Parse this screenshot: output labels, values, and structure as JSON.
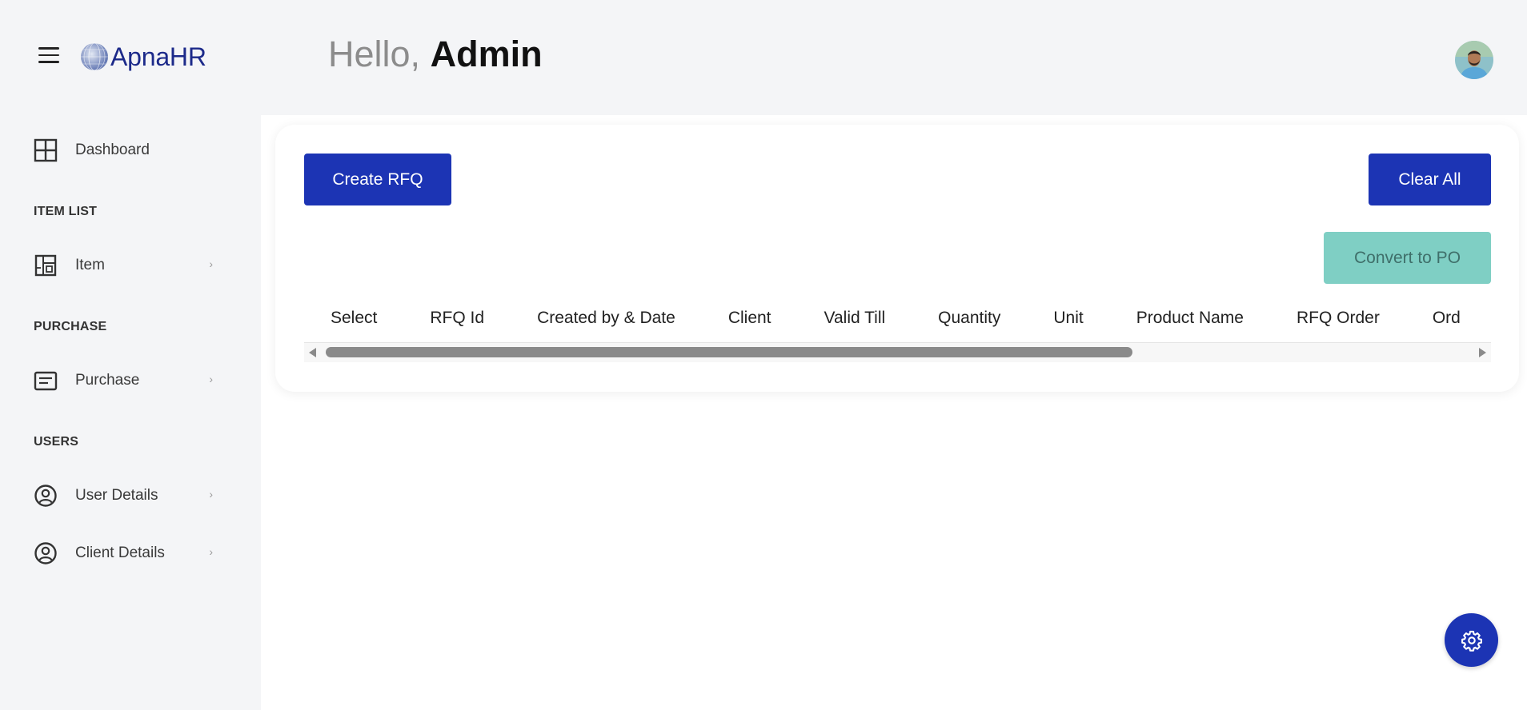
{
  "header": {
    "logo_text": "ApnaHR",
    "greeting_prefix": "Hello,",
    "user_name": "Admin"
  },
  "sidebar": {
    "dashboard_label": "Dashboard",
    "sections": [
      {
        "title": "ITEM LIST",
        "items": [
          {
            "label": "Item",
            "icon": "item-grid-icon"
          }
        ]
      },
      {
        "title": "PURCHASE",
        "items": [
          {
            "label": "Purchase",
            "icon": "purchase-doc-icon"
          }
        ]
      },
      {
        "title": "USERS",
        "items": [
          {
            "label": "User Details",
            "icon": "user-circle-icon"
          },
          {
            "label": "Client Details",
            "icon": "user-circle-icon"
          }
        ]
      }
    ]
  },
  "main": {
    "create_button": "Create RFQ",
    "clear_button": "Clear All",
    "convert_button": "Convert to PO",
    "table_headers": [
      "Select",
      "RFQ Id",
      "Created by & Date",
      "Client",
      "Valid Till",
      "Quantity",
      "Unit",
      "Product Name",
      "RFQ Order",
      "Ord"
    ]
  },
  "colors": {
    "primary": "#1c34b4",
    "convert_disabled": "#7fcfc4",
    "background": "#f4f5f7"
  }
}
